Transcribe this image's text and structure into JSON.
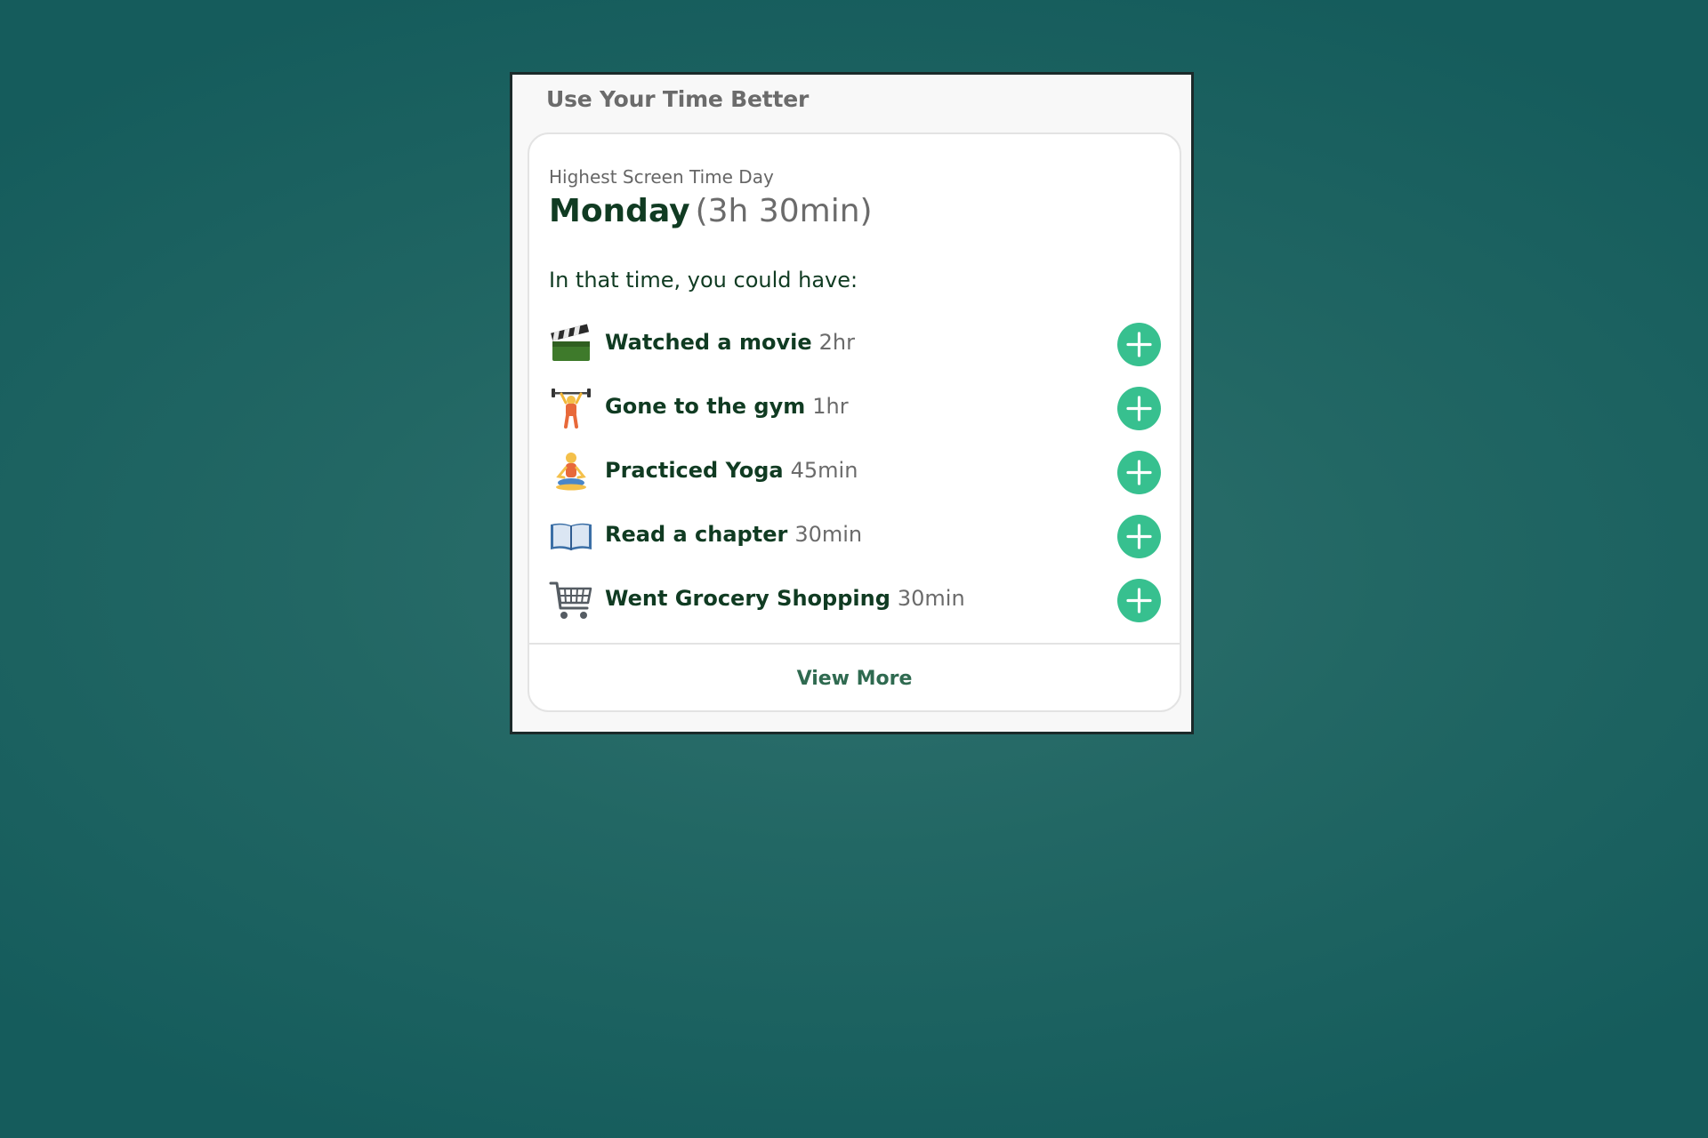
{
  "widget": {
    "title": "Use Your Time Better"
  },
  "summary": {
    "label": "Highest Screen Time Day",
    "day": "Monday",
    "duration": "(3h 30min)",
    "intro": "In that time, you could have:"
  },
  "activities": [
    {
      "icon": "clapper-board-icon",
      "name": "Watched a movie",
      "time": "2hr"
    },
    {
      "icon": "weightlifter-icon",
      "name": "Gone to the gym",
      "time": "1hr"
    },
    {
      "icon": "yoga-icon",
      "name": "Practiced Yoga",
      "time": "45min"
    },
    {
      "icon": "open-book-icon",
      "name": "Read a chapter",
      "time": "30min"
    },
    {
      "icon": "shopping-cart-icon",
      "name": "Went Grocery Shopping",
      "time": "30min"
    }
  ],
  "actions": {
    "view_more": "View More"
  },
  "colors": {
    "background": "#1f6563",
    "accent": "#37c08f",
    "text_dark": "#103b22",
    "text_muted": "#6b6b6b",
    "link": "#2f6a50"
  }
}
